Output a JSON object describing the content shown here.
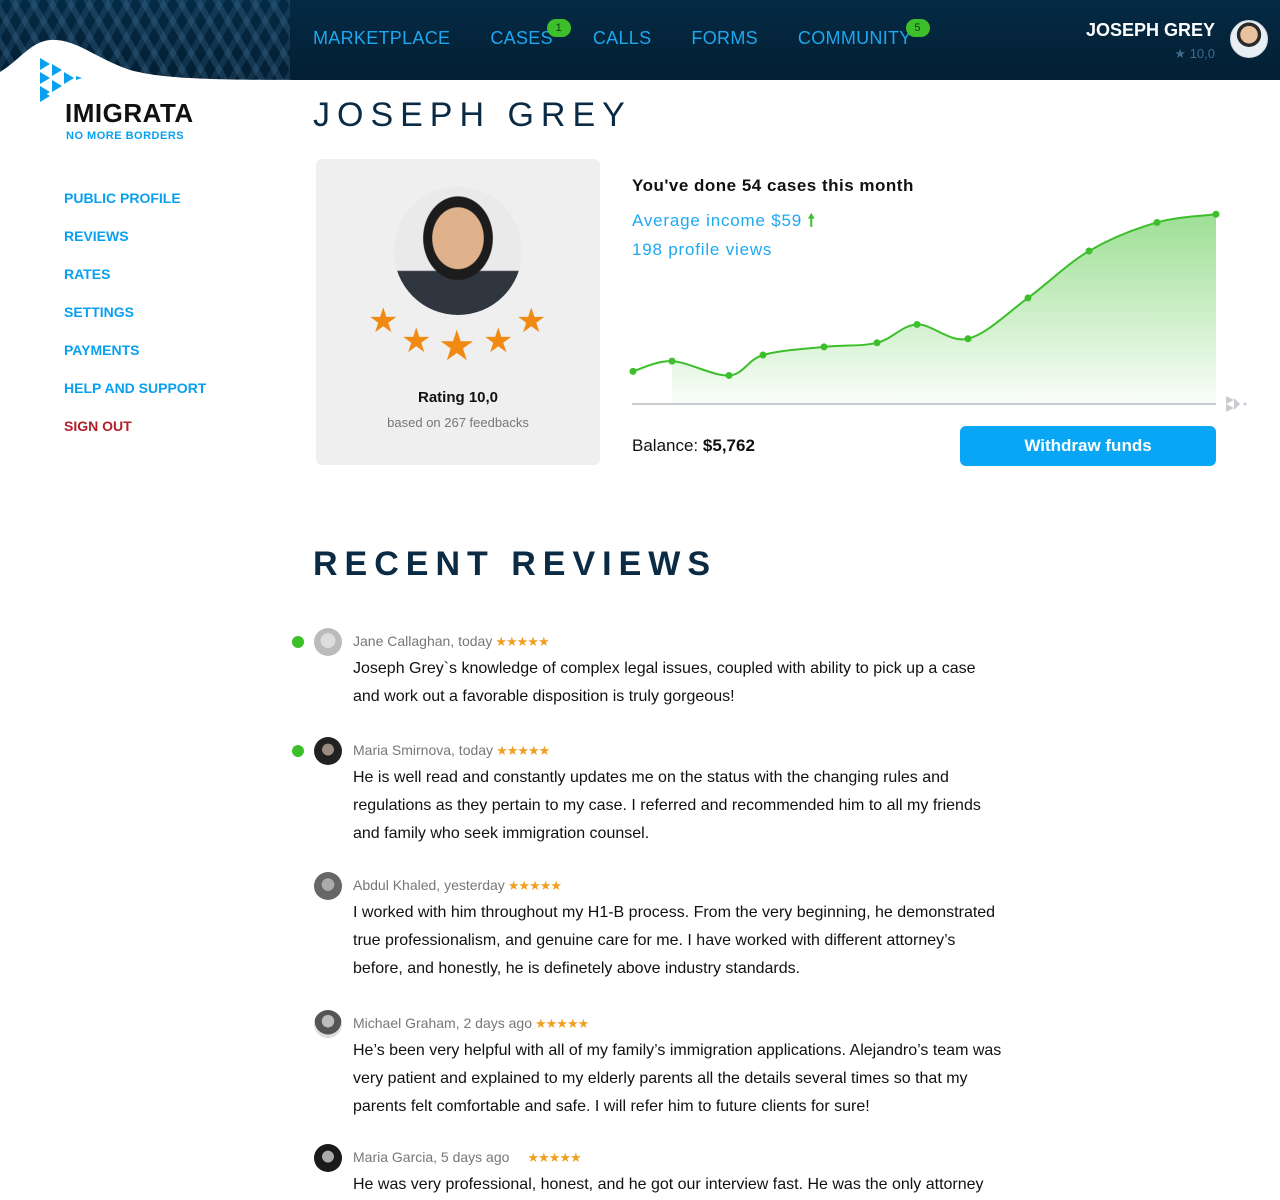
{
  "brand": {
    "name": "IMIGRATA",
    "tagline": "NO MORE BORDERS",
    "logo_icon": "arrow-chevrons-logo-icon"
  },
  "nav": {
    "items": [
      {
        "label": "MARKETPLACE",
        "badge": null
      },
      {
        "label": "CASES",
        "badge": "1"
      },
      {
        "label": "CALLS",
        "badge": null
      },
      {
        "label": "FORMS",
        "badge": null
      },
      {
        "label": "COMMUNITY",
        "badge": "5"
      }
    ]
  },
  "user": {
    "name": "JOSEPH GREY",
    "rating": "10,0",
    "rating_icon": "star-icon"
  },
  "sidebar": {
    "items": [
      {
        "label": "PUBLIC PROFILE"
      },
      {
        "label": "REVIEWS"
      },
      {
        "label": "RATES"
      },
      {
        "label": "SETTINGS"
      },
      {
        "label": "PAYMENTS"
      },
      {
        "label": "HELP AND SUPPORT"
      },
      {
        "label": "SIGN OUT"
      }
    ]
  },
  "page": {
    "title": "JOSEPH GREY"
  },
  "profile_card": {
    "stars": 5,
    "rating_label": "Rating 10,0",
    "feedback_label": "based on 267 feedbacks"
  },
  "stats": {
    "cases_label": "You've done 54 cases this month",
    "income_label": "Average income $59",
    "views_label": "198 profile views",
    "balance_label": "Balance:",
    "balance_value": "$5,762",
    "withdraw_label": "Withdraw funds"
  },
  "colors": {
    "accent": "#09a6f5",
    "success": "#3cbf2a",
    "star": "#f18a12",
    "header_bg": "#042a44",
    "danger": "#b3202a"
  },
  "chart_data": {
    "type": "area",
    "title": "",
    "xlabel": "",
    "ylabel": "",
    "x": [
      1,
      2,
      3,
      4,
      5,
      6,
      7,
      8,
      9,
      10,
      11,
      12
    ],
    "values": [
      16,
      21,
      14,
      24,
      28,
      30,
      39,
      32,
      52,
      75,
      89,
      93
    ],
    "ylim": [
      0,
      100
    ],
    "grid": false,
    "legend": "none",
    "series_color": "#3cbf2a"
  },
  "reviews": {
    "title": "RECENT REVIEWS",
    "items": [
      {
        "author": "Jane Callaghan, today",
        "new": true,
        "stars": "★★★★★",
        "text": "Joseph Grey`s knowledge of complex legal issues, coupled with ability to pick up a case and work out a favorable disposition is truly gorgeous!"
      },
      {
        "author": "Maria Smirnova, today",
        "new": true,
        "stars": "★★★★★",
        "text": "He is well read and constantly updates me on the status with the changing rules and regulations as they pertain to my case. I referred and recommended him to all my friends and family who seek immigration counsel."
      },
      {
        "author": "Abdul Khaled, yesterday",
        "new": false,
        "stars": "★★★★★",
        "text": "I worked with him throughout my H1-B process. From the very beginning, he demonstrated true professionalism, and genuine care for me. I have worked with different attorney’s before, and honestly, he is definetely above industry standards."
      },
      {
        "author": "Michael Graham, 2 days ago",
        "new": false,
        "stars": "★★★★★",
        "text": "He’s been very helpful with all of my family’s immigration applications. Alejandro’s team was very patient and explained to my elderly parents all the details several times so that my parents felt comfortable and safe. I will refer him to future clients for sure!"
      },
      {
        "author": "Maria Garcia, 5 days ago",
        "new": false,
        "stars": "★★★★★",
        "text": "He was very professional, honest, and he got our interview fast. He was the only attorney"
      }
    ]
  }
}
